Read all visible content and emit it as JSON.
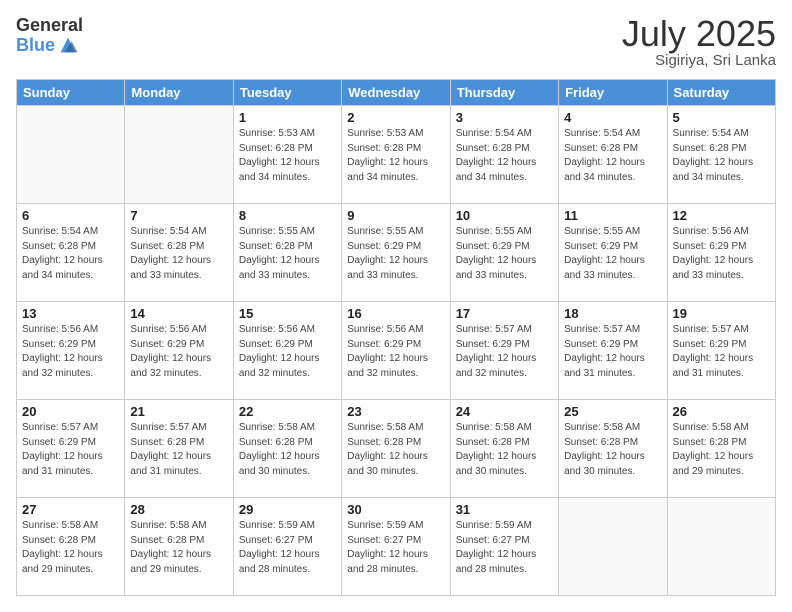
{
  "logo": {
    "general": "General",
    "blue": "Blue"
  },
  "title": {
    "month": "July 2025",
    "location": "Sigiriya, Sri Lanka"
  },
  "header": {
    "days": [
      "Sunday",
      "Monday",
      "Tuesday",
      "Wednesday",
      "Thursday",
      "Friday",
      "Saturday"
    ]
  },
  "weeks": [
    [
      {
        "day": "",
        "info": ""
      },
      {
        "day": "",
        "info": ""
      },
      {
        "day": "1",
        "info": "Sunrise: 5:53 AM\nSunset: 6:28 PM\nDaylight: 12 hours and 34 minutes."
      },
      {
        "day": "2",
        "info": "Sunrise: 5:53 AM\nSunset: 6:28 PM\nDaylight: 12 hours and 34 minutes."
      },
      {
        "day": "3",
        "info": "Sunrise: 5:54 AM\nSunset: 6:28 PM\nDaylight: 12 hours and 34 minutes."
      },
      {
        "day": "4",
        "info": "Sunrise: 5:54 AM\nSunset: 6:28 PM\nDaylight: 12 hours and 34 minutes."
      },
      {
        "day": "5",
        "info": "Sunrise: 5:54 AM\nSunset: 6:28 PM\nDaylight: 12 hours and 34 minutes."
      }
    ],
    [
      {
        "day": "6",
        "info": "Sunrise: 5:54 AM\nSunset: 6:28 PM\nDaylight: 12 hours and 34 minutes."
      },
      {
        "day": "7",
        "info": "Sunrise: 5:54 AM\nSunset: 6:28 PM\nDaylight: 12 hours and 33 minutes."
      },
      {
        "day": "8",
        "info": "Sunrise: 5:55 AM\nSunset: 6:28 PM\nDaylight: 12 hours and 33 minutes."
      },
      {
        "day": "9",
        "info": "Sunrise: 5:55 AM\nSunset: 6:29 PM\nDaylight: 12 hours and 33 minutes."
      },
      {
        "day": "10",
        "info": "Sunrise: 5:55 AM\nSunset: 6:29 PM\nDaylight: 12 hours and 33 minutes."
      },
      {
        "day": "11",
        "info": "Sunrise: 5:55 AM\nSunset: 6:29 PM\nDaylight: 12 hours and 33 minutes."
      },
      {
        "day": "12",
        "info": "Sunrise: 5:56 AM\nSunset: 6:29 PM\nDaylight: 12 hours and 33 minutes."
      }
    ],
    [
      {
        "day": "13",
        "info": "Sunrise: 5:56 AM\nSunset: 6:29 PM\nDaylight: 12 hours and 32 minutes."
      },
      {
        "day": "14",
        "info": "Sunrise: 5:56 AM\nSunset: 6:29 PM\nDaylight: 12 hours and 32 minutes."
      },
      {
        "day": "15",
        "info": "Sunrise: 5:56 AM\nSunset: 6:29 PM\nDaylight: 12 hours and 32 minutes."
      },
      {
        "day": "16",
        "info": "Sunrise: 5:56 AM\nSunset: 6:29 PM\nDaylight: 12 hours and 32 minutes."
      },
      {
        "day": "17",
        "info": "Sunrise: 5:57 AM\nSunset: 6:29 PM\nDaylight: 12 hours and 32 minutes."
      },
      {
        "day": "18",
        "info": "Sunrise: 5:57 AM\nSunset: 6:29 PM\nDaylight: 12 hours and 31 minutes."
      },
      {
        "day": "19",
        "info": "Sunrise: 5:57 AM\nSunset: 6:29 PM\nDaylight: 12 hours and 31 minutes."
      }
    ],
    [
      {
        "day": "20",
        "info": "Sunrise: 5:57 AM\nSunset: 6:29 PM\nDaylight: 12 hours and 31 minutes."
      },
      {
        "day": "21",
        "info": "Sunrise: 5:57 AM\nSunset: 6:28 PM\nDaylight: 12 hours and 31 minutes."
      },
      {
        "day": "22",
        "info": "Sunrise: 5:58 AM\nSunset: 6:28 PM\nDaylight: 12 hours and 30 minutes."
      },
      {
        "day": "23",
        "info": "Sunrise: 5:58 AM\nSunset: 6:28 PM\nDaylight: 12 hours and 30 minutes."
      },
      {
        "day": "24",
        "info": "Sunrise: 5:58 AM\nSunset: 6:28 PM\nDaylight: 12 hours and 30 minutes."
      },
      {
        "day": "25",
        "info": "Sunrise: 5:58 AM\nSunset: 6:28 PM\nDaylight: 12 hours and 30 minutes."
      },
      {
        "day": "26",
        "info": "Sunrise: 5:58 AM\nSunset: 6:28 PM\nDaylight: 12 hours and 29 minutes."
      }
    ],
    [
      {
        "day": "27",
        "info": "Sunrise: 5:58 AM\nSunset: 6:28 PM\nDaylight: 12 hours and 29 minutes."
      },
      {
        "day": "28",
        "info": "Sunrise: 5:58 AM\nSunset: 6:28 PM\nDaylight: 12 hours and 29 minutes."
      },
      {
        "day": "29",
        "info": "Sunrise: 5:59 AM\nSunset: 6:27 PM\nDaylight: 12 hours and 28 minutes."
      },
      {
        "day": "30",
        "info": "Sunrise: 5:59 AM\nSunset: 6:27 PM\nDaylight: 12 hours and 28 minutes."
      },
      {
        "day": "31",
        "info": "Sunrise: 5:59 AM\nSunset: 6:27 PM\nDaylight: 12 hours and 28 minutes."
      },
      {
        "day": "",
        "info": ""
      },
      {
        "day": "",
        "info": ""
      }
    ]
  ]
}
